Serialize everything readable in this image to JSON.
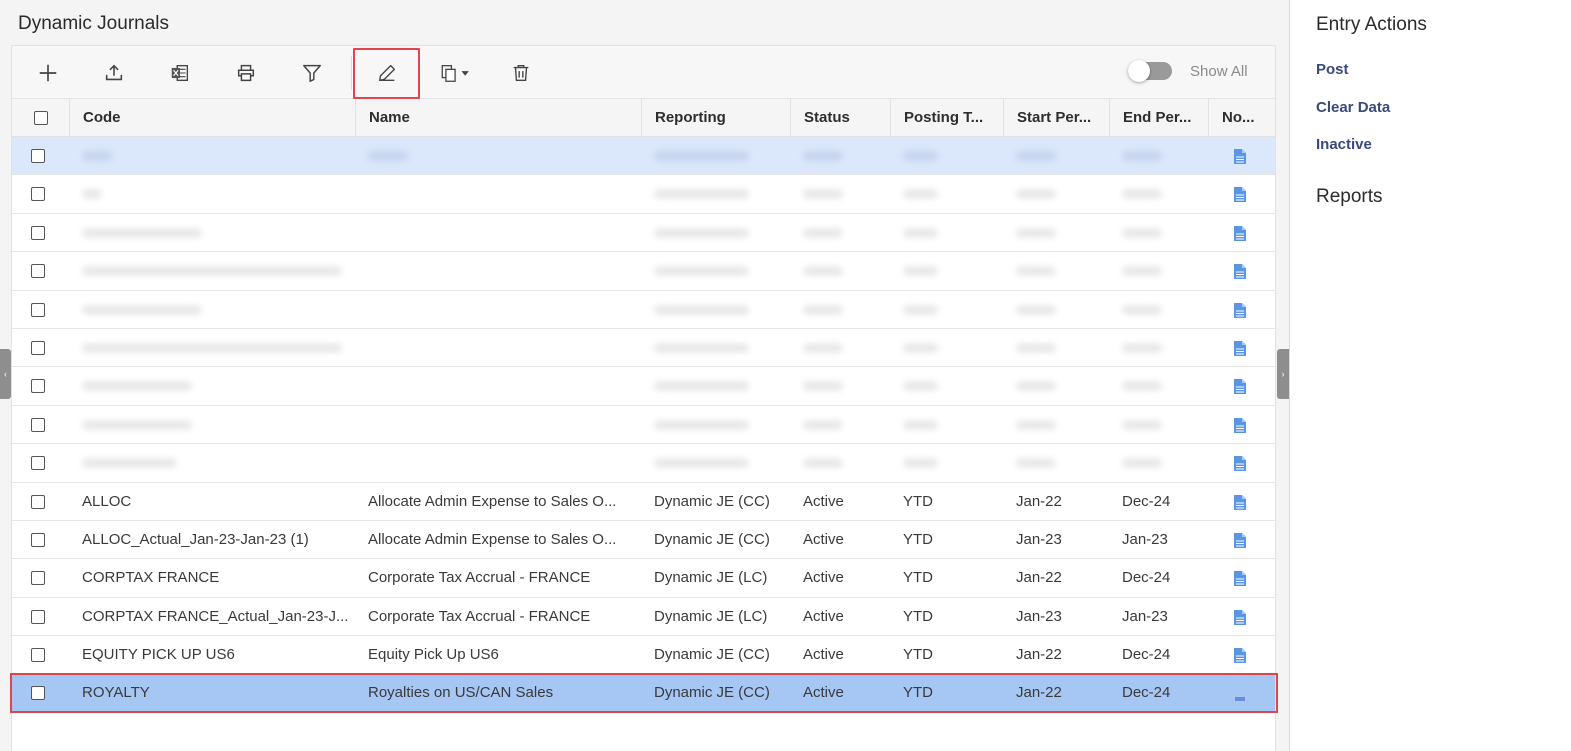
{
  "page_title": "Dynamic Journals",
  "toolbar": {
    "add_icon": "plus-icon",
    "upload_icon": "upload-icon",
    "excel_icon": "excel-icon",
    "print_icon": "print-icon",
    "filter_icon": "filter-icon",
    "edit_icon": "pencil-icon",
    "copy_icon": "copy-icon",
    "delete_icon": "trash-icon",
    "show_all_label": "Show All",
    "show_all_on": false
  },
  "columns": [
    "Code",
    "Name",
    "Reporting",
    "Status",
    "Posting T...",
    "Start Per...",
    "End Per...",
    "No..."
  ],
  "rows": [
    {
      "code": "",
      "name": "",
      "reporting": "",
      "status": "",
      "posting": "",
      "start": "",
      "end": "",
      "blurred": true,
      "highlight": true
    },
    {
      "code": "",
      "name": "",
      "reporting": "",
      "status": "",
      "posting": "",
      "start": "",
      "end": "",
      "blurred": true
    },
    {
      "code": "",
      "name": "",
      "reporting": "",
      "status": "",
      "posting": "",
      "start": "",
      "end": "",
      "blurred": true
    },
    {
      "code": "",
      "name": "",
      "reporting": "",
      "status": "",
      "posting": "",
      "start": "",
      "end": "",
      "blurred": true
    },
    {
      "code": "",
      "name": "",
      "reporting": "",
      "status": "",
      "posting": "",
      "start": "",
      "end": "",
      "blurred": true
    },
    {
      "code": "",
      "name": "",
      "reporting": "",
      "status": "",
      "posting": "",
      "start": "",
      "end": "",
      "blurred": true
    },
    {
      "code": "",
      "name": "",
      "reporting": "",
      "status": "",
      "posting": "",
      "start": "",
      "end": "",
      "blurred": true
    },
    {
      "code": "",
      "name": "",
      "reporting": "",
      "status": "",
      "posting": "",
      "start": "",
      "end": "",
      "blurred": true
    },
    {
      "code": "",
      "name": "",
      "reporting": "",
      "status": "",
      "posting": "",
      "start": "",
      "end": "",
      "blurred": true
    },
    {
      "code": "ALLOC",
      "name": "Allocate Admin Expense to Sales O...",
      "reporting": "Dynamic JE (CC)",
      "status": "Active",
      "posting": "YTD",
      "start": "Jan-22",
      "end": "Dec-24"
    },
    {
      "code": "ALLOC_Actual_Jan-23-Jan-23 (1)",
      "name": "Allocate Admin Expense to Sales O...",
      "reporting": "Dynamic JE (CC)",
      "status": "Active",
      "posting": "YTD",
      "start": "Jan-23",
      "end": "Jan-23"
    },
    {
      "code": "CORPTAX FRANCE",
      "name": "Corporate Tax Accrual - FRANCE",
      "reporting": "Dynamic JE (LC)",
      "status": "Active",
      "posting": "YTD",
      "start": "Jan-22",
      "end": "Dec-24"
    },
    {
      "code": "CORPTAX FRANCE_Actual_Jan-23-J...",
      "name": "Corporate Tax Accrual - FRANCE",
      "reporting": "Dynamic JE (LC)",
      "status": "Active",
      "posting": "YTD",
      "start": "Jan-23",
      "end": "Jan-23"
    },
    {
      "code": "EQUITY PICK UP US6",
      "name": "Equity Pick Up US6",
      "reporting": "Dynamic JE (CC)",
      "status": "Active",
      "posting": "YTD",
      "start": "Jan-22",
      "end": "Dec-24"
    },
    {
      "code": "ROYALTY",
      "name": "Royalties on US/CAN Sales",
      "reporting": "Dynamic JE (CC)",
      "status": "Active",
      "posting": "YTD",
      "start": "Jan-22",
      "end": "Dec-24",
      "selected": true
    }
  ],
  "entry_actions": {
    "title": "Entry Actions",
    "items": [
      "Post",
      "Clear Data",
      "Inactive"
    ]
  },
  "reports": {
    "title": "Reports"
  },
  "colors": {
    "highlight_row": "#dbe7fb",
    "selected_row": "#a6c6f4",
    "annotation_red": "#e0474c",
    "link": "#3a4a7a"
  }
}
